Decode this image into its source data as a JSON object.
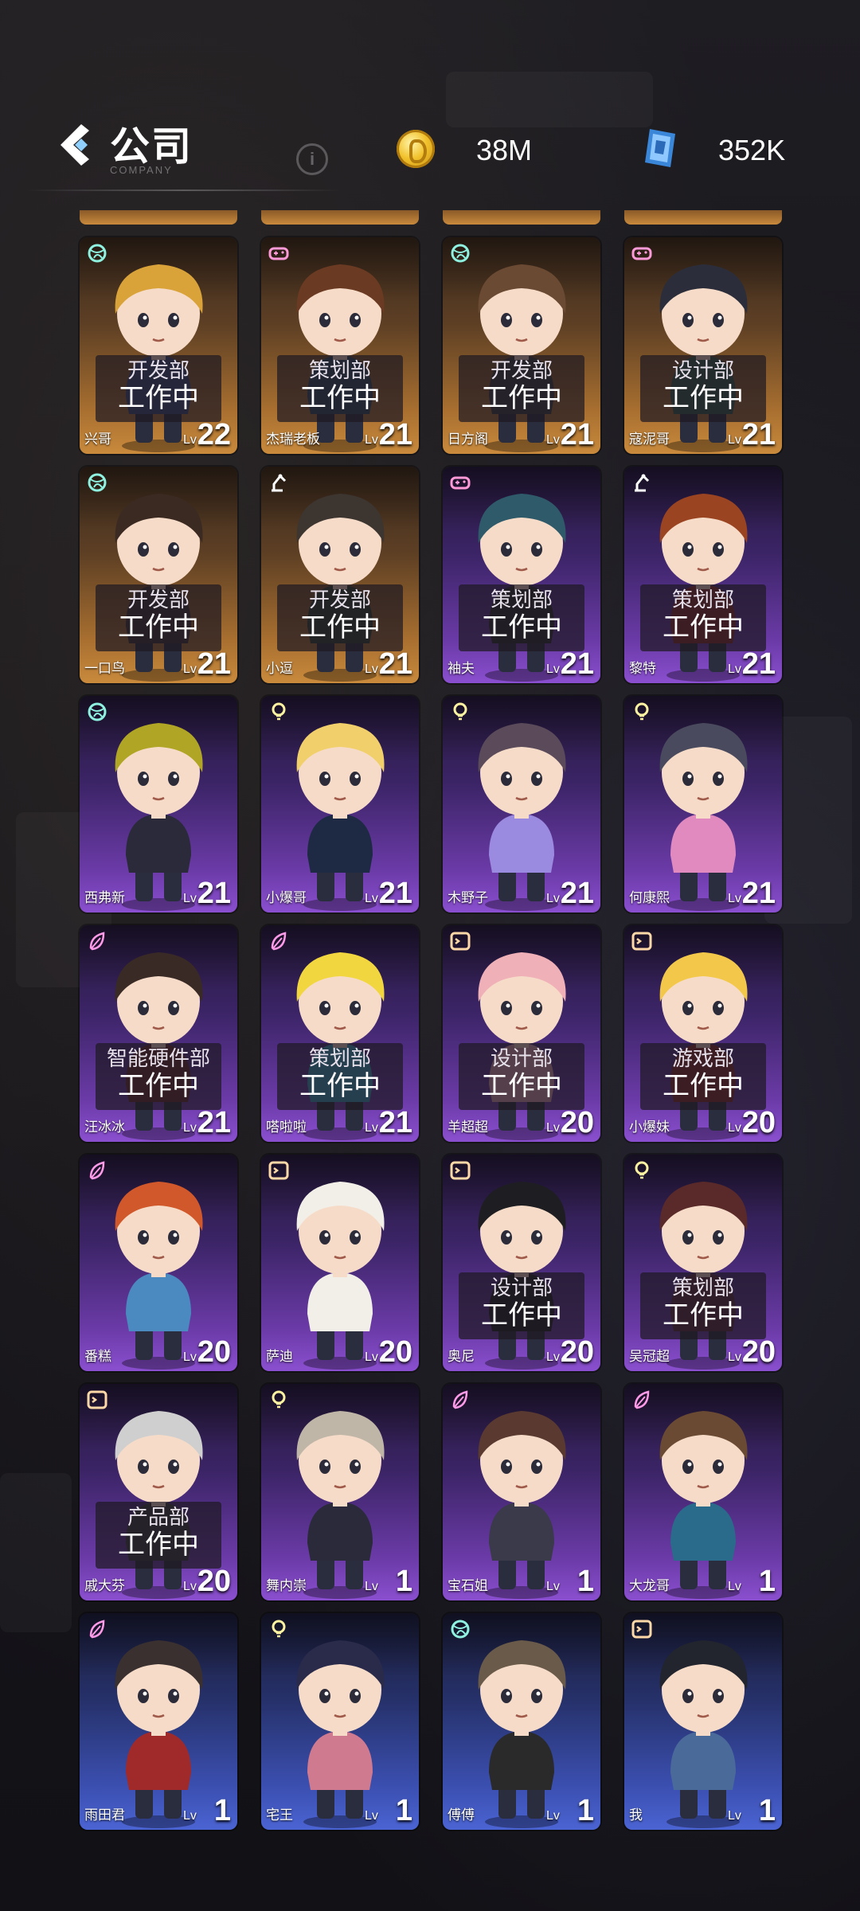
{
  "header": {
    "title": "公司",
    "subtitle": "COMPANY",
    "coins": "38M",
    "gems": "352K"
  },
  "colors": {
    "orange_card": "#c98a3c",
    "purple_card": "#8a4fcf",
    "blue_card": "#4b64d3",
    "coin": "#f1c22d",
    "gem": "#4aa0e8"
  },
  "employees": [
    {
      "name": "兴哥",
      "level": "22",
      "rarity": "orange",
      "icon": "globe-icon",
      "dept": "开发部",
      "status": "工作中",
      "hair": "#d9a33a",
      "shirt": "#3a4a7a"
    },
    {
      "name": "杰瑞老板",
      "level": "21",
      "rarity": "orange",
      "icon": "gamepad-icon",
      "dept": "策划部",
      "status": "工作中",
      "hair": "#6b3a22",
      "shirt": "#2e4a5a"
    },
    {
      "name": "日方阁",
      "level": "21",
      "rarity": "orange",
      "icon": "globe-icon",
      "dept": "开发部",
      "status": "工作中",
      "hair": "#6b4a33",
      "shirt": "#3a3a3a"
    },
    {
      "name": "寇泥哥",
      "level": "21",
      "rarity": "orange",
      "icon": "gamepad-icon",
      "dept": "设计部",
      "status": "工作中",
      "hair": "#2b2e3a",
      "shirt": "#2f5a4a"
    },
    {
      "name": "一口鸟",
      "level": "21",
      "rarity": "orange",
      "icon": "globe-icon",
      "dept": "开发部",
      "status": "工作中",
      "hair": "#3b2a22",
      "shirt": "#3a3030"
    },
    {
      "name": "小逗",
      "level": "21",
      "rarity": "orange",
      "icon": "arm-icon",
      "dept": "开发部",
      "status": "工作中",
      "hair": "#3d3530",
      "shirt": "#2e3e2e"
    },
    {
      "name": "袖夫",
      "level": "21",
      "rarity": "purple",
      "icon": "gamepad-icon",
      "dept": "策划部",
      "status": "工作中",
      "hair": "#2f5a6a",
      "shirt": "#2a2a2a"
    },
    {
      "name": "黎特",
      "level": "21",
      "rarity": "purple",
      "icon": "arm-icon",
      "dept": "策划部",
      "status": "工作中",
      "hair": "#9a4422",
      "shirt": "#8a2a2a"
    },
    {
      "name": "西弗新",
      "level": "21",
      "rarity": "purple",
      "icon": "globe-icon",
      "dept": "",
      "status": "",
      "hair": "#b0a524",
      "shirt": "#2a2a3a"
    },
    {
      "name": "小爆哥",
      "level": "21",
      "rarity": "purple",
      "icon": "bulb-icon",
      "dept": "",
      "status": "",
      "hair": "#f1cf6a",
      "shirt": "#1e2a44"
    },
    {
      "name": "木野子",
      "level": "21",
      "rarity": "purple",
      "icon": "bulb-icon",
      "dept": "",
      "status": "",
      "hair": "#5a4a5a",
      "shirt": "#9a8ae0"
    },
    {
      "name": "何康熙",
      "level": "21",
      "rarity": "purple",
      "icon": "bulb-icon",
      "dept": "",
      "status": "",
      "hair": "#4a4a5e",
      "shirt": "#e08ac0"
    },
    {
      "name": "汪冰冰",
      "level": "21",
      "rarity": "purple",
      "icon": "feather-icon",
      "dept": "智能硬件部",
      "status": "工作中",
      "hair": "#3a2a26",
      "shirt": "#6a2a2a"
    },
    {
      "name": "嗒啦啦",
      "level": "21",
      "rarity": "purple",
      "icon": "feather-icon",
      "dept": "策划部",
      "status": "工作中",
      "hair": "#f2d640",
      "shirt": "#3aa0c0"
    },
    {
      "name": "羊超超",
      "level": "20",
      "rarity": "purple",
      "icon": "terminal-icon",
      "dept": "设计部",
      "status": "工作中",
      "hair": "#f0b0b8",
      "shirt": "#e0a0b0"
    },
    {
      "name": "小爆妹",
      "level": "20",
      "rarity": "purple",
      "icon": "terminal-icon",
      "dept": "游戏部",
      "status": "工作中",
      "hair": "#f3c84a",
      "shirt": "#8a2a2a"
    },
    {
      "name": "番糕",
      "level": "20",
      "rarity": "purple",
      "icon": "feather-icon",
      "dept": "",
      "status": "",
      "hair": "#d0582a",
      "shirt": "#4a8ac0"
    },
    {
      "name": "萨迪",
      "level": "20",
      "rarity": "purple",
      "icon": "terminal-icon",
      "dept": "",
      "status": "",
      "hair": "#f2efe8",
      "shirt": "#f2efe8"
    },
    {
      "name": "奥尼",
      "level": "20",
      "rarity": "purple",
      "icon": "terminal-icon",
      "dept": "设计部",
      "status": "工作中",
      "hair": "#1e1e22",
      "shirt": "#1e1e22"
    },
    {
      "name": "吴冠超",
      "level": "20",
      "rarity": "purple",
      "icon": "bulb-icon",
      "dept": "策划部",
      "status": "工作中",
      "hair": "#5a2a2a",
      "shirt": "#5a2a3a"
    },
    {
      "name": "戚大芬",
      "level": "20",
      "rarity": "purple",
      "icon": "terminal-icon",
      "dept": "产品部",
      "status": "工作中",
      "hair": "#cfcfcf",
      "shirt": "#3a3a3a"
    },
    {
      "name": "舞内崇",
      "level": "1",
      "rarity": "purple",
      "icon": "bulb-icon",
      "dept": "",
      "status": "",
      "hair": "#c0b6a8",
      "shirt": "#2a2a3a"
    },
    {
      "name": "宝石姐",
      "level": "1",
      "rarity": "purple",
      "icon": "feather-icon",
      "dept": "",
      "status": "",
      "hair": "#5a3a30",
      "shirt": "#3a3a4a"
    },
    {
      "name": "大龙哥",
      "level": "1",
      "rarity": "purple",
      "icon": "feather-icon",
      "dept": "",
      "status": "",
      "hair": "#6a4a33",
      "shirt": "#2a6a8a"
    },
    {
      "name": "雨田君",
      "level": "1",
      "rarity": "blue",
      "icon": "feather-icon",
      "dept": "",
      "status": "",
      "hair": "#3a3030",
      "shirt": "#a02a2a"
    },
    {
      "name": "宅王",
      "level": "1",
      "rarity": "blue",
      "icon": "bulb-icon",
      "dept": "",
      "status": "",
      "hair": "#2a2a4a",
      "shirt": "#d07a90"
    },
    {
      "name": "傅傅",
      "level": "1",
      "rarity": "blue",
      "icon": "globe-icon",
      "dept": "",
      "status": "",
      "hair": "#6a5a4a",
      "shirt": "#2a2a2a"
    },
    {
      "name": "我",
      "level": "1",
      "rarity": "blue",
      "icon": "terminal-icon",
      "dept": "",
      "status": "",
      "hair": "#22242e",
      "shirt": "#4a6a9a"
    }
  ],
  "labels": {
    "lv": "Lv"
  }
}
